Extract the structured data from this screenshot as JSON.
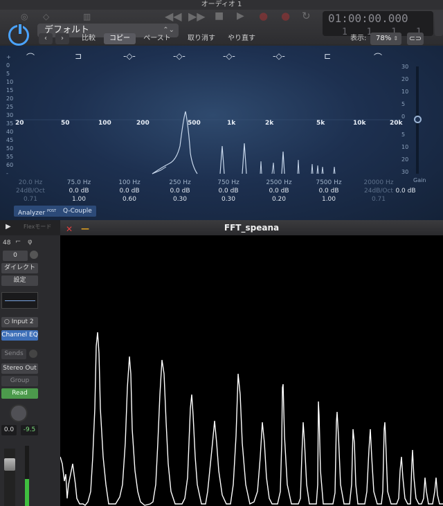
{
  "window_title": "オーディオ 1",
  "transport": {
    "timecode": "01:00:00.000",
    "bars": "1 1 1 1"
  },
  "plugin": {
    "preset": "デフォルト",
    "toolbar": {
      "compare": "比較",
      "copy": "コピー",
      "paste": "ペースト",
      "undo": "取り消す",
      "redo": "やり直す"
    },
    "view_label": "表示:",
    "zoom": "78%"
  },
  "eq": {
    "db_left": [
      "+",
      "0",
      "5",
      "10",
      "15",
      "20",
      "25",
      "30",
      "35",
      "40",
      "45",
      "50",
      "55",
      "60",
      "-"
    ],
    "db_right_top": [
      "30",
      "20",
      "10",
      "5",
      "0"
    ],
    "db_right_bottom": [
      "5",
      "10",
      "20",
      "30"
    ],
    "freq_labels": [
      "20",
      "50",
      "100",
      "200",
      "500",
      "1k",
      "2k",
      "5k",
      "10k",
      "20k"
    ],
    "gain_label": "Gain",
    "bands": [
      {
        "freq": "20.0 Hz",
        "gain": "24dB/Oct",
        "q": "0.71",
        "on": false
      },
      {
        "freq": "75.0 Hz",
        "gain": "0.0 dB",
        "q": "1.00",
        "on": true
      },
      {
        "freq": "100 Hz",
        "gain": "0.0 dB",
        "q": "0.60",
        "on": true
      },
      {
        "freq": "250 Hz",
        "gain": "0.0 dB",
        "q": "0.30",
        "on": true
      },
      {
        "freq": "750 Hz",
        "gain": "0.0 dB",
        "q": "0.30",
        "on": true
      },
      {
        "freq": "2500 Hz",
        "gain": "0.0 dB",
        "q": "0.20",
        "on": true
      },
      {
        "freq": "7500 Hz",
        "gain": "0.0 dB",
        "q": "1.00",
        "on": true
      },
      {
        "freq": "20000 Hz",
        "gain": "24dB/Oct",
        "q": "0.71",
        "on": false
      }
    ],
    "master_gain": "0.0 dB",
    "analyzer_label": "Analyzer",
    "analyzer_post": "POST",
    "qcouple_label": "Q-Couple"
  },
  "strip": {
    "channel_number": "48",
    "input_value": "0",
    "direct": "ダイレクト",
    "settings": "設定",
    "input": "Input 2",
    "plugin": "Channel EQ",
    "sends": "Sends",
    "output": "Stereo Out",
    "group": "Group",
    "automation": "Read",
    "pan_value": "0.0",
    "level_value": "-9.5",
    "flex_mode": "Flexモード"
  },
  "fft": {
    "title": "FFT_speana"
  },
  "colors": {
    "accent": "#4aa3ff",
    "eq_bg": "#1d3050",
    "read_green": "#4c9a4c"
  }
}
